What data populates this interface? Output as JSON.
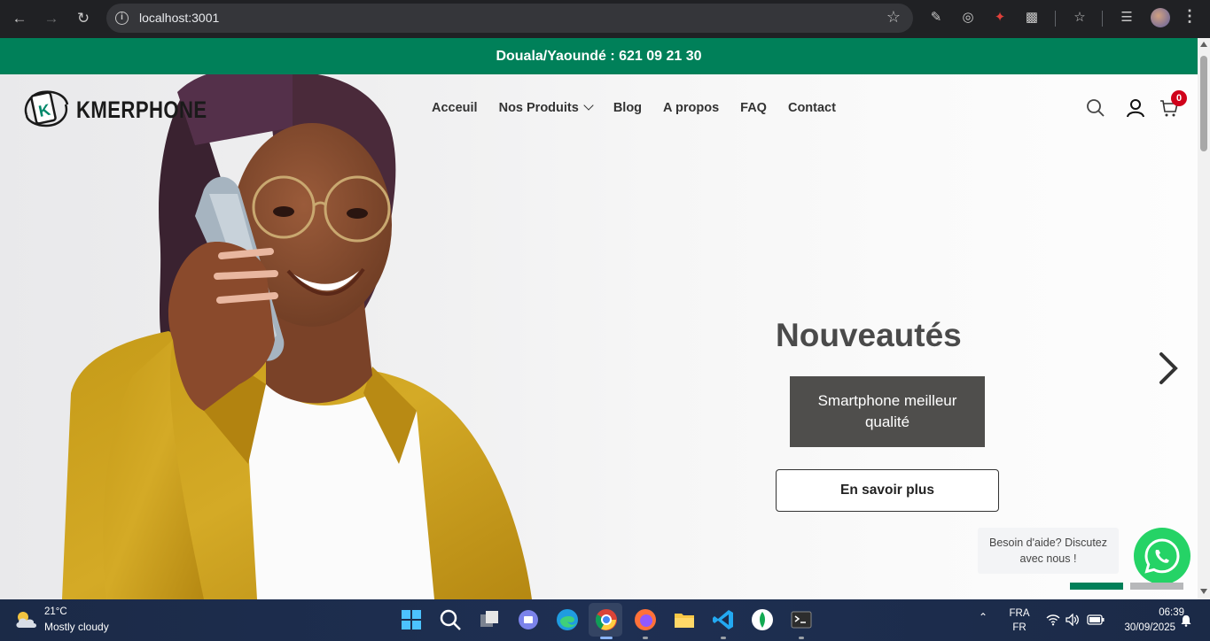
{
  "browser": {
    "url": "localhost:3001"
  },
  "site": {
    "topbar_text": "Douala/Yaoundé : 621 09 21 30",
    "logo_text": "KMERPHONE",
    "menu": [
      {
        "label": "Acceuil"
      },
      {
        "label": "Nos Produits"
      },
      {
        "label": "Blog"
      },
      {
        "label": "A propos"
      },
      {
        "label": "FAQ"
      },
      {
        "label": "Contact"
      }
    ],
    "cart_count": "0",
    "slide": {
      "title": "Nouveautés",
      "subtitle_line1": "Smartphone meilleur",
      "subtitle_line2": "qualité",
      "cta": "En savoir plus"
    },
    "help": {
      "line1": "Besoin d'aide? Discutez",
      "line2": "avec nous !"
    },
    "colors": {
      "brand_green": "#008059",
      "badge_red": "#d0021b",
      "whatsapp": "#25d366"
    }
  },
  "taskbar": {
    "weather_temp": "21°C",
    "weather_desc": "Mostly cloudy",
    "lang_top": "FRA",
    "lang_bottom": "FR",
    "time": "06:39",
    "date": "30/09/2025"
  }
}
